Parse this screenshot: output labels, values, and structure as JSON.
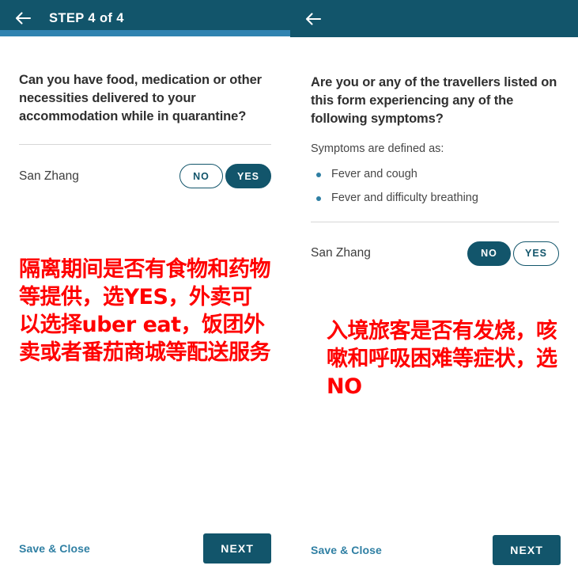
{
  "left_panel": {
    "header": {
      "back_icon": "arrow-left-icon",
      "title": "STEP 4 of 4",
      "progress_percent": 100,
      "bar_color": "#3083b0",
      "bg_color": "#12556b"
    },
    "question": "Can you have food, medication or other necessities delivered to your accommodation while in quarantine?",
    "answer": {
      "person_name": "San Zhang",
      "options": [
        {
          "label": "NO",
          "selected": false
        },
        {
          "label": "YES",
          "selected": true
        }
      ]
    },
    "annotation": "隔离期间是否有食物和药物等提供，选YES，外卖可以选择uber eat，饭团外卖或者番茄商城等配送服务",
    "annotation_color": "#ff0000",
    "footer": {
      "save_label": "Save & Close",
      "next_label": "NEXT"
    }
  },
  "right_panel": {
    "header": {
      "back_icon": "arrow-left-icon",
      "title": "",
      "bg_color": "#12556b"
    },
    "question": "Are you or any of the travellers listed on this form experiencing any of the following symptoms?",
    "sub_label": "Symptoms are defined as:",
    "symptoms": [
      "Fever and cough",
      "Fever and difficulty breathing"
    ],
    "bullet_color": "#2f7fa3",
    "answer": {
      "person_name": "San Zhang",
      "options": [
        {
          "label": "NO",
          "selected": true
        },
        {
          "label": "YES",
          "selected": false
        }
      ]
    },
    "annotation": "入境旅客是否有发烧，咳嗽和呼吸困难等症状，选NO",
    "annotation_color": "#ff0000",
    "footer": {
      "save_label": "Save & Close",
      "next_label": "NEXT"
    }
  }
}
